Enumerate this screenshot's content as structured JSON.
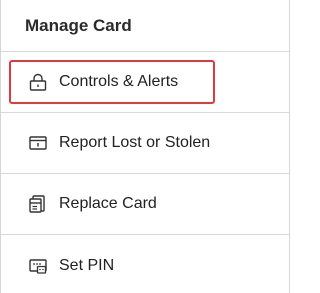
{
  "panel": {
    "title": "Manage Card",
    "items": [
      {
        "label": "Controls & Alerts",
        "icon": "lock-icon",
        "highlighted": true
      },
      {
        "label": "Report Lost or Stolen",
        "icon": "card-report-icon",
        "highlighted": false
      },
      {
        "label": "Replace Card",
        "icon": "card-replace-icon",
        "highlighted": false
      },
      {
        "label": "Set PIN",
        "icon": "pin-keypad-icon",
        "highlighted": false
      }
    ]
  },
  "colors": {
    "highlight": "#e0393e",
    "text": "#222222",
    "divider": "#d9d9d9"
  }
}
